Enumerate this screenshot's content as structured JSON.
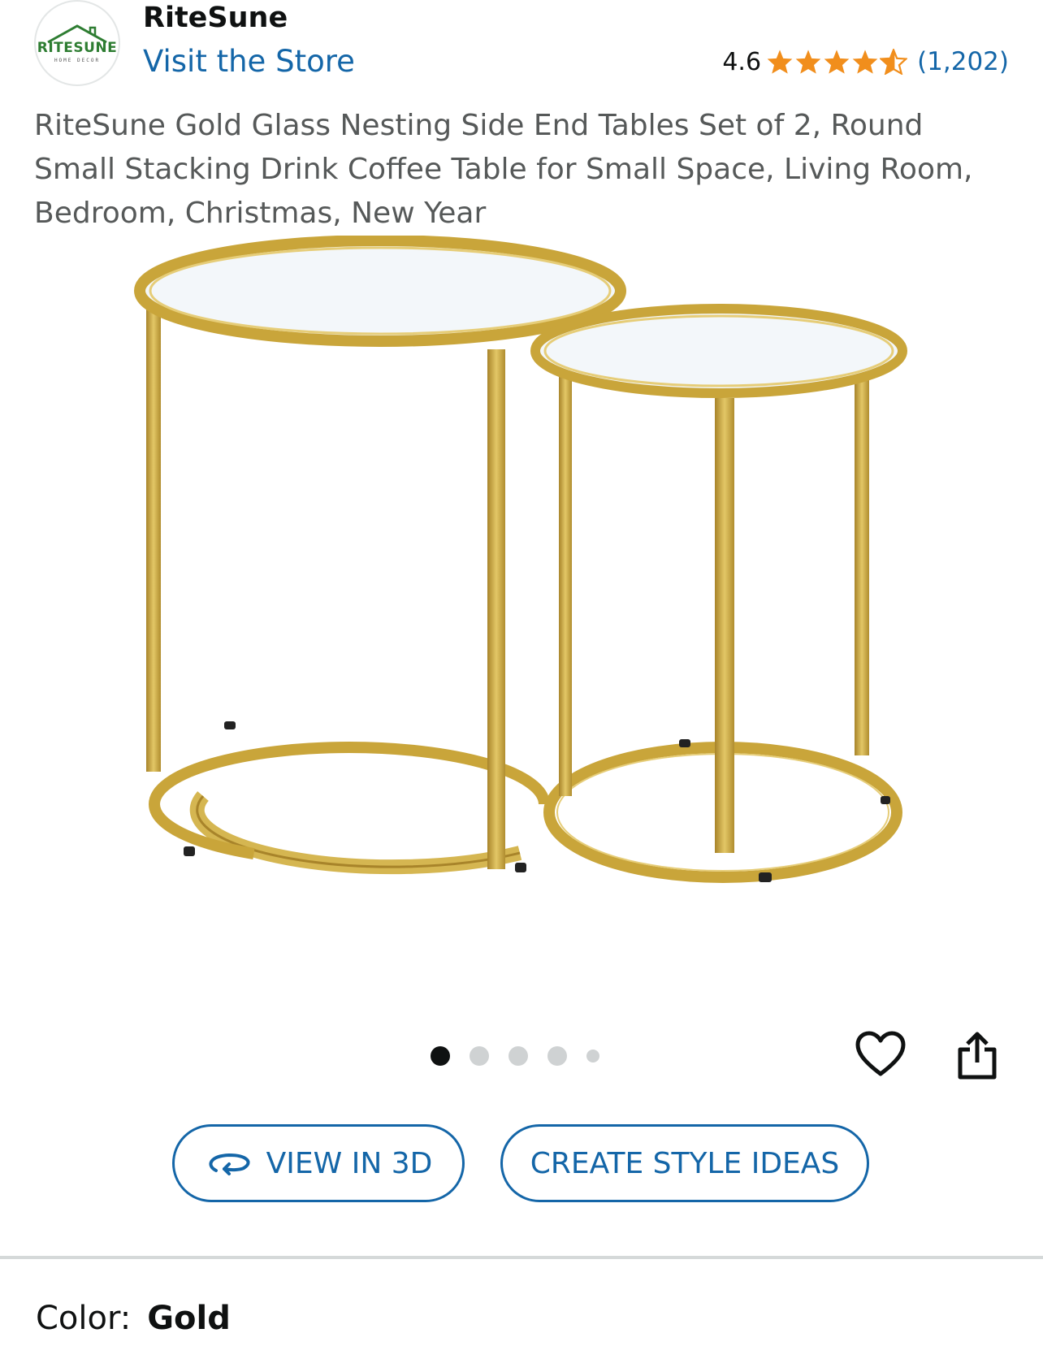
{
  "header": {
    "brand_name": "RiteSune",
    "visit_store_label": "Visit the Store",
    "logo": {
      "word": "RITESUNE",
      "sub": "HOME DECOR"
    },
    "rating": {
      "value": "4.6",
      "stars": 4.6,
      "count": "(1,202)"
    }
  },
  "product": {
    "title": "RiteSune Gold Glass Nesting Side End Tables Set of 2, Round Small Stacking Drink Coffee Table for Small Space, Living Room, Bedroom, Christmas, New Year"
  },
  "carousel": {
    "total": 5,
    "active": 1
  },
  "actions": {
    "view_3d_label": "VIEW IN 3D",
    "style_ideas_label": "CREATE STYLE IDEAS"
  },
  "variation": {
    "label": "Color:",
    "value": "Gold"
  },
  "colors": {
    "link": "#1466a8",
    "star": "#f18e1c",
    "gold": "#c9a53a",
    "text": "#0f1111",
    "muted": "#565959"
  },
  "icons": [
    "star-icon",
    "heart-icon",
    "share-icon",
    "rotate-3d-icon"
  ]
}
